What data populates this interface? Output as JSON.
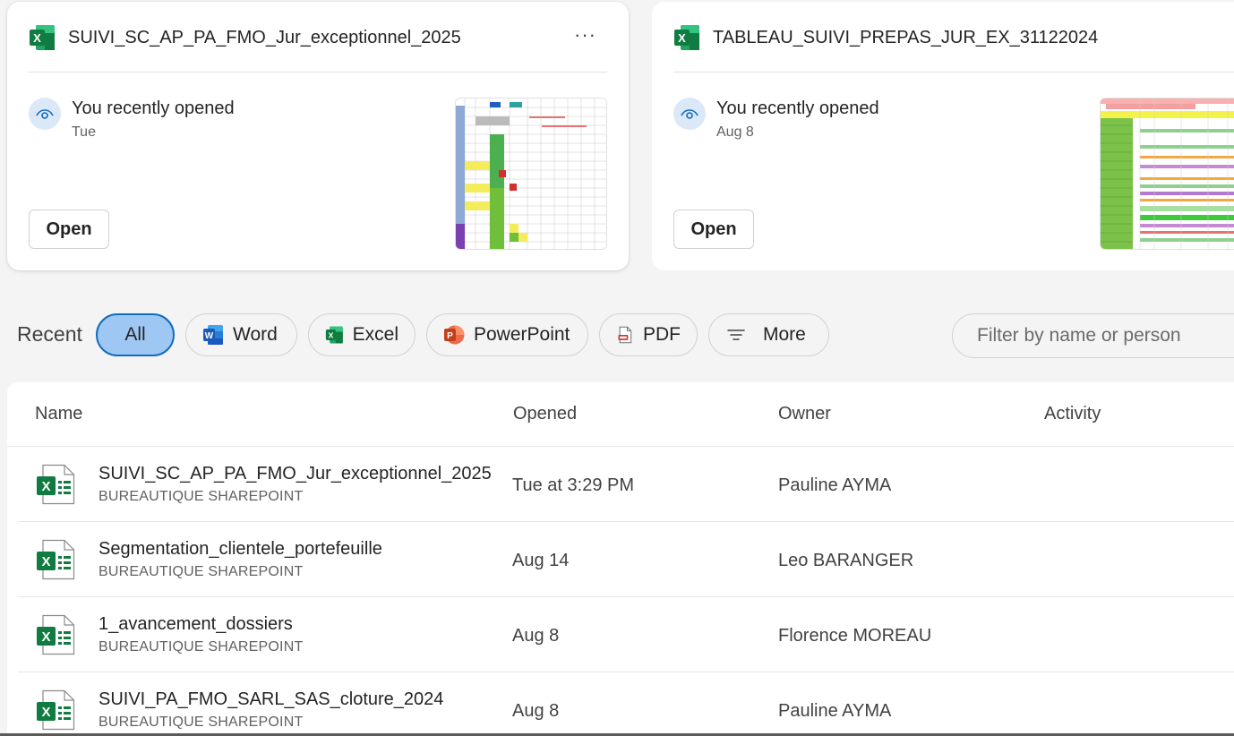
{
  "cards": [
    {
      "title": "SUIVI_SC_AP_PA_FMO_Jur_exceptionnel_2025",
      "activity": "You recently opened",
      "when": "Tue",
      "open_label": "Open",
      "more_label": "···"
    },
    {
      "title": "TABLEAU_SUIVI_PREPAS_JUR_EX_31122024",
      "activity": "You recently opened",
      "when": "Aug 8",
      "open_label": "Open"
    }
  ],
  "filters": {
    "recent_label": "Recent",
    "all": "All",
    "word": "Word",
    "excel": "Excel",
    "powerpoint": "PowerPoint",
    "pdf": "PDF",
    "more": "More",
    "search_placeholder": "Filter by name or person"
  },
  "table": {
    "headers": {
      "name": "Name",
      "opened": "Opened",
      "owner": "Owner",
      "activity": "Activity"
    },
    "rows": [
      {
        "name": "SUIVI_SC_AP_PA_FMO_Jur_exceptionnel_2025",
        "location": "BUREAUTIQUE SHAREPOINT",
        "opened": "Tue at 3:29 PM",
        "owner": "Pauline AYMA"
      },
      {
        "name": "Segmentation_clientele_portefeuille",
        "location": "BUREAUTIQUE SHAREPOINT",
        "opened": "Aug 14",
        "owner": "Leo BARANGER"
      },
      {
        "name": "1_avancement_dossiers",
        "location": "BUREAUTIQUE SHAREPOINT",
        "opened": "Aug 8",
        "owner": "Florence MOREAU"
      },
      {
        "name": "SUIVI_PA_FMO_SARL_SAS_cloture_2024",
        "location": "BUREAUTIQUE SHAREPOINT",
        "opened": "Aug 8",
        "owner": "Pauline AYMA"
      }
    ]
  },
  "colors": {
    "excel_green": "#107c41",
    "accent": "#0f6cbd",
    "selected_pill": "#9fc7f3"
  }
}
